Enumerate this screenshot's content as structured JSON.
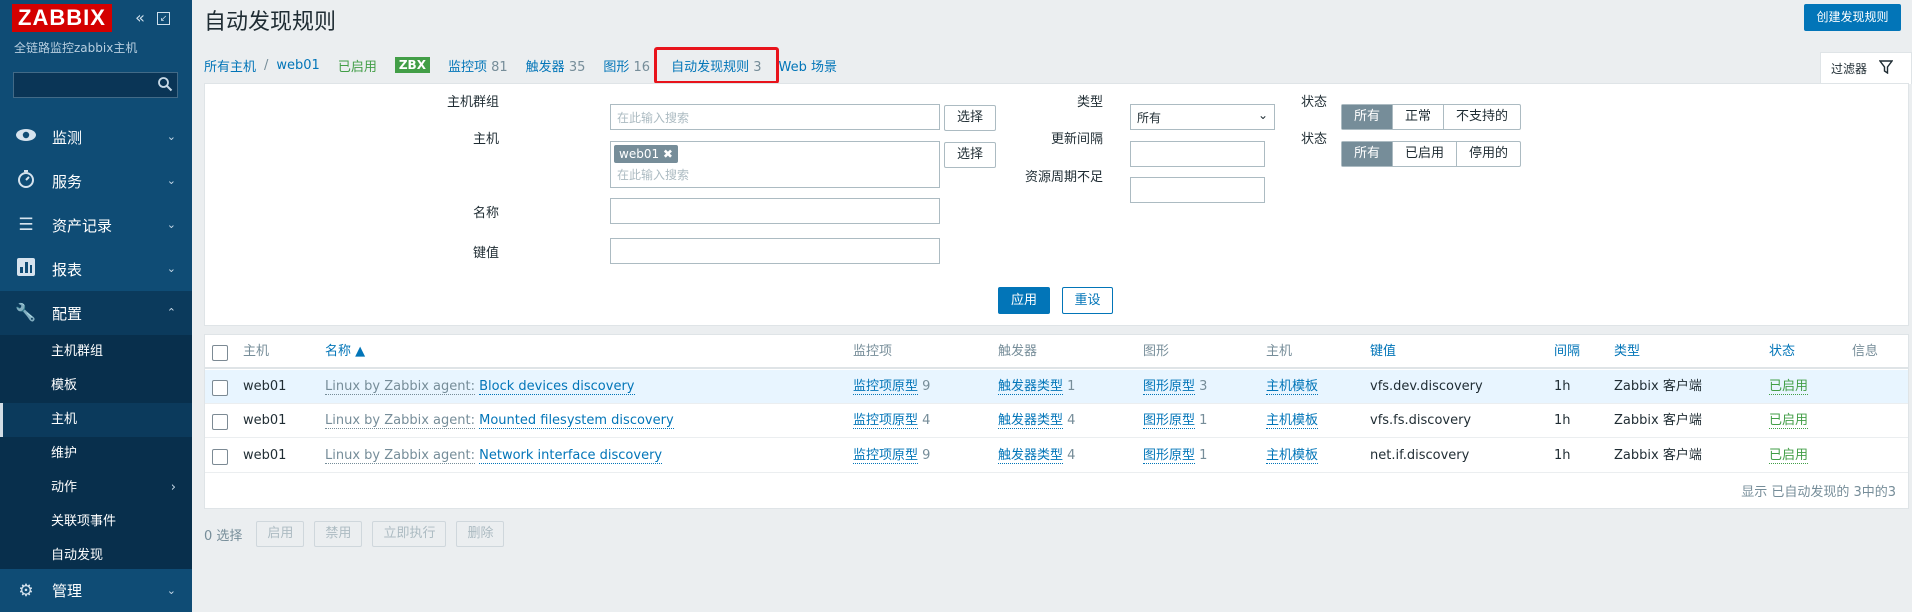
{
  "sidebar": {
    "logo": "ZABBIX",
    "subtitle": "全链路监控zabbix主机",
    "collapse_icon": "double-chevron-left-icon",
    "kiosk_icon": "expand-icon",
    "search_icon": "search-icon",
    "menu": [
      {
        "label": "监测",
        "icon": "eye-icon"
      },
      {
        "label": "服务",
        "icon": "clock-icon"
      },
      {
        "label": "资产记录",
        "icon": "list-icon"
      },
      {
        "label": "报表",
        "icon": "chart-icon"
      },
      {
        "label": "配置",
        "icon": "wrench-icon"
      }
    ],
    "submenu": [
      "主机群组",
      "模板",
      "主机",
      "维护",
      "动作",
      "关联项事件",
      "自动发现"
    ],
    "admin": {
      "label": "管理",
      "icon": "gear-icon"
    }
  },
  "header": {
    "title": "自动发现规则",
    "create_button": "创建发现规则"
  },
  "breadcrumb": {
    "all_hosts": "所有主机",
    "host": "web01",
    "enabled": "已启用",
    "zbx": "ZBX",
    "items": {
      "label": "监控项",
      "count": "81"
    },
    "triggers": {
      "label": "触发器",
      "count": "35"
    },
    "graphs": {
      "label": "图形",
      "count": "16"
    },
    "discovery": {
      "label": "自动发现规则",
      "count": "3"
    },
    "web": "Web 场景"
  },
  "filter": {
    "tab_label": "过滤器",
    "host_groups_label": "主机群组",
    "host_groups_placeholder": "在此输入搜索",
    "select_btn": "选择",
    "hosts_label": "主机",
    "host_tag": "web01",
    "hosts_placeholder": "在此输入搜索",
    "name_label": "名称",
    "key_label": "键值",
    "type_label": "类型",
    "type_value": "所有",
    "update_interval_label": "更新间隔",
    "keep_lost_label": "资源周期不足",
    "state_label": "状态",
    "state_options": [
      "所有",
      "正常",
      "不支持的"
    ],
    "status_label": "状态",
    "status_options": [
      "所有",
      "已启用",
      "停用的"
    ],
    "apply": "应用",
    "reset": "重设"
  },
  "table": {
    "headers": [
      "主机",
      "名称 ▲",
      "监控项",
      "触发器",
      "图形",
      "主机",
      "键值",
      "间隔",
      "类型",
      "状态",
      "信息"
    ],
    "rows": [
      {
        "host": "web01",
        "template": "Linux by Zabbix agent:",
        "name": "Block devices discovery",
        "items": "监控项原型",
        "items_n": "9",
        "triggers": "触发器类型",
        "triggers_n": "1",
        "graphs": "图形原型",
        "graphs_n": "3",
        "hosts": "主机模板",
        "key": "vfs.dev.discovery",
        "interval": "1h",
        "type": "Zabbix 客户端",
        "status": "已启用"
      },
      {
        "host": "web01",
        "template": "Linux by Zabbix agent:",
        "name": "Mounted filesystem discovery",
        "items": "监控项原型",
        "items_n": "4",
        "triggers": "触发器类型",
        "triggers_n": "4",
        "graphs": "图形原型",
        "graphs_n": "1",
        "hosts": "主机模板",
        "key": "vfs.fs.discovery",
        "interval": "1h",
        "type": "Zabbix 客户端",
        "status": "已启用"
      },
      {
        "host": "web01",
        "template": "Linux by Zabbix agent:",
        "name": "Network interface discovery",
        "items": "监控项原型",
        "items_n": "9",
        "triggers": "触发器类型",
        "triggers_n": "4",
        "graphs": "图形原型",
        "graphs_n": "1",
        "hosts": "主机模板",
        "key": "net.if.discovery",
        "interval": "1h",
        "type": "Zabbix 客户端",
        "status": "已启用"
      }
    ],
    "footer": "显示 已自动发现的 3中的3"
  },
  "actions": {
    "selected": "0 选择",
    "buttons": [
      "启用",
      "禁用",
      "立即执行",
      "删除"
    ]
  },
  "colors": {
    "accent": "#0275b8",
    "sidebar": "#0f4c75",
    "highlight": "#e8131b",
    "enabled": "#429e47"
  }
}
